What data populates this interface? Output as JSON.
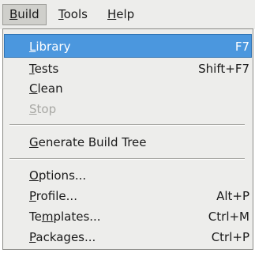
{
  "menubar": {
    "items": [
      {
        "pre": "",
        "mnemonic": "B",
        "post": "uild"
      },
      {
        "pre": "",
        "mnemonic": "T",
        "post": "ools"
      },
      {
        "pre": "",
        "mnemonic": "H",
        "post": "elp"
      }
    ]
  },
  "build_menu": {
    "items": [
      {
        "pre": "",
        "mnemonic": "L",
        "post": "ibrary",
        "shortcut": "F7"
      },
      {
        "pre": "",
        "mnemonic": "T",
        "post": "ests",
        "shortcut": "Shift+F7"
      },
      {
        "pre": "",
        "mnemonic": "C",
        "post": "lean",
        "shortcut": ""
      },
      {
        "pre": "",
        "mnemonic": "S",
        "post": "top",
        "shortcut": ""
      },
      {
        "pre": "",
        "mnemonic": "G",
        "post": "enerate Build Tree",
        "shortcut": ""
      },
      {
        "pre": "",
        "mnemonic": "O",
        "post": "ptions...",
        "shortcut": ""
      },
      {
        "pre": "",
        "mnemonic": "P",
        "post": "rofile...",
        "shortcut": "Alt+P"
      },
      {
        "pre": "Te",
        "mnemonic": "m",
        "post": "plates...",
        "shortcut": "Ctrl+M"
      },
      {
        "pre": "",
        "mnemonic": "P",
        "post": "ackages...",
        "shortcut": "Ctrl+P"
      }
    ]
  },
  "colors": {
    "highlight": "#4b97de",
    "menu_background": "#ededeb",
    "disabled_text": "#a8a8a4"
  }
}
